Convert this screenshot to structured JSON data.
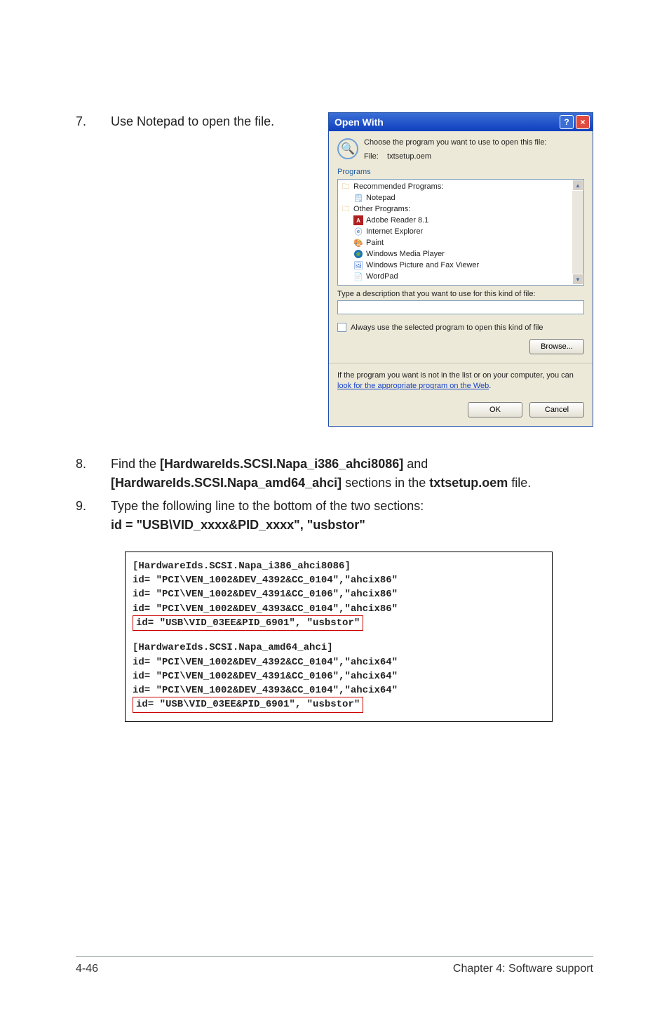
{
  "step7": {
    "num": "7.",
    "text": "Use Notepad to open the file."
  },
  "dialog": {
    "title": "Open With",
    "help_btn": "?",
    "close_btn": "×",
    "choose_line": "Choose the program you want to use to open this file:",
    "file_label": "File:",
    "file_name": "txtsetup.oem",
    "programs_label": "Programs",
    "recommended_label": "Recommended Programs:",
    "notepad": "Notepad",
    "other_label": "Other Programs:",
    "adobe": "Adobe Reader 8.1",
    "ie": "Internet Explorer",
    "paint": "Paint",
    "wmp": "Windows Media Player",
    "wpf": "Windows Picture and Fax Viewer",
    "wordpad": "WordPad",
    "desc_label": "Type a description that you want to use for this kind of file:",
    "desc_value": "",
    "always_label": "Always use the selected program to open this kind of file",
    "browse_label": "Browse...",
    "web_note_pre": "If the program you want is not in the list or on your computer, you can ",
    "web_note_link": "look for the appropriate program on the Web",
    "web_note_post": ".",
    "ok_label": "OK",
    "cancel_label": "Cancel"
  },
  "step8": {
    "num": "8.",
    "pre": "Find the ",
    "b1": "[HardwareIds.SCSI.Napa_i386_ahci8086]",
    "mid": " and ",
    "b2": "[HardwareIds.SCSI.Napa_amd64_ahci]",
    "aft": " sections in the ",
    "b3": "txtsetup.oem",
    "end": " file."
  },
  "step9": {
    "num": "9.",
    "line1": "Type the following line to the bottom of the two sections:",
    "line2": "id = \"USB\\VID_xxxx&PID_xxxx\", \"usbstor\""
  },
  "code": {
    "l1": "[HardwareIds.SCSI.Napa_i386_ahci8086]",
    "l2": "id= \"PCI\\VEN_1002&DEV_4392&CC_0104\",\"ahcix86\"",
    "l3": "id= \"PCI\\VEN_1002&DEV_4391&CC_0106\",\"ahcix86\"",
    "l4": "id= \"PCI\\VEN_1002&DEV_4393&CC_0104\",\"ahcix86\"",
    "l5": "id= \"USB\\VID_03EE&PID_6901\", \"usbstor\"",
    "l6": "[HardwareIds.SCSI.Napa_amd64_ahci]",
    "l7": "id= \"PCI\\VEN_1002&DEV_4392&CC_0104\",\"ahcix64\"",
    "l8": "id= \"PCI\\VEN_1002&DEV_4391&CC_0106\",\"ahcix64\"",
    "l9": "id= \"PCI\\VEN_1002&DEV_4393&CC_0104\",\"ahcix64\"",
    "l10": "id= \"USB\\VID_03EE&PID_6901\", \"usbstor\""
  },
  "footer": {
    "left": "4-46",
    "right": "Chapter 4: Software support"
  }
}
